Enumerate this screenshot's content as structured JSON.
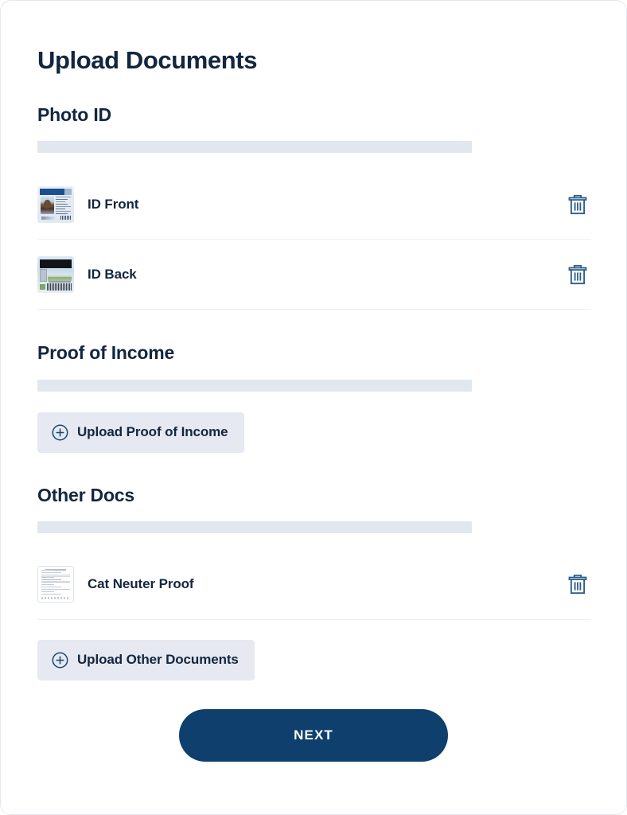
{
  "page": {
    "title": "Upload Documents"
  },
  "sections": [
    {
      "id": "photo-id",
      "heading": "Photo ID",
      "documents": [
        {
          "name": "ID Front",
          "thumbnail": "drivers-license-front-image",
          "delete_icon": "trash-icon"
        },
        {
          "name": "ID Back",
          "thumbnail": "drivers-license-back-image",
          "delete_icon": "trash-icon"
        }
      ]
    },
    {
      "id": "proof-of-income",
      "heading": "Proof of Income",
      "documents": [],
      "upload_button": {
        "label": "Upload Proof of Income",
        "icon": "plus-circle-icon"
      }
    },
    {
      "id": "other-docs",
      "heading": "Other Docs",
      "documents": [
        {
          "name": "Cat Neuter Proof",
          "thumbnail": "scanned-document-image",
          "delete_icon": "trash-icon"
        }
      ],
      "upload_button": {
        "label": "Upload Other Documents",
        "icon": "plus-circle-icon"
      }
    }
  ],
  "footer": {
    "next_label": "NEXT"
  },
  "colors": {
    "text_primary": "#12263f",
    "placeholder_bar": "#e2e6ef",
    "upload_button_bg": "#e6e9f1",
    "next_button_bg": "#0e3f6d",
    "trash_icon": "#2b5c8a",
    "divider": "#eceef5"
  }
}
